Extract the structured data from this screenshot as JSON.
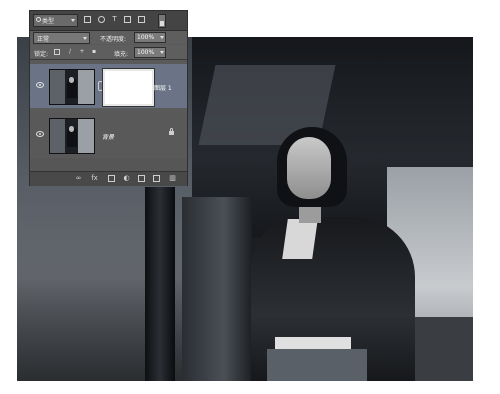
{
  "layers_panel": {
    "filter_kind": "类型",
    "filter_icons": [
      "image-filter-icon",
      "adjustment-filter-icon",
      "type-filter-icon",
      "shape-filter-icon",
      "smart-object-filter-icon"
    ],
    "blend_mode": "正常",
    "opacity_label": "不透明度:",
    "opacity_value": "100%",
    "lock_label": "锁定:",
    "lock_icons": [
      "lock-transparent-icon",
      "lock-image-icon",
      "lock-position-icon",
      "lock-all-icon"
    ],
    "fill_label": "填充:",
    "fill_value": "100%",
    "layers": [
      {
        "name": "图层 1",
        "selected": true,
        "has_mask": true
      },
      {
        "name": "背景",
        "selected": false,
        "has_mask": false,
        "locked": true
      }
    ],
    "footer_icons": [
      "link-layers-icon",
      "fx-icon",
      "add-mask-icon",
      "adjustment-layer-icon",
      "new-group-icon",
      "new-layer-icon",
      "delete-layer-icon"
    ]
  },
  "colors": {
    "panel_bg": "#5a5a5a",
    "selected_layer": "#6a7486"
  }
}
